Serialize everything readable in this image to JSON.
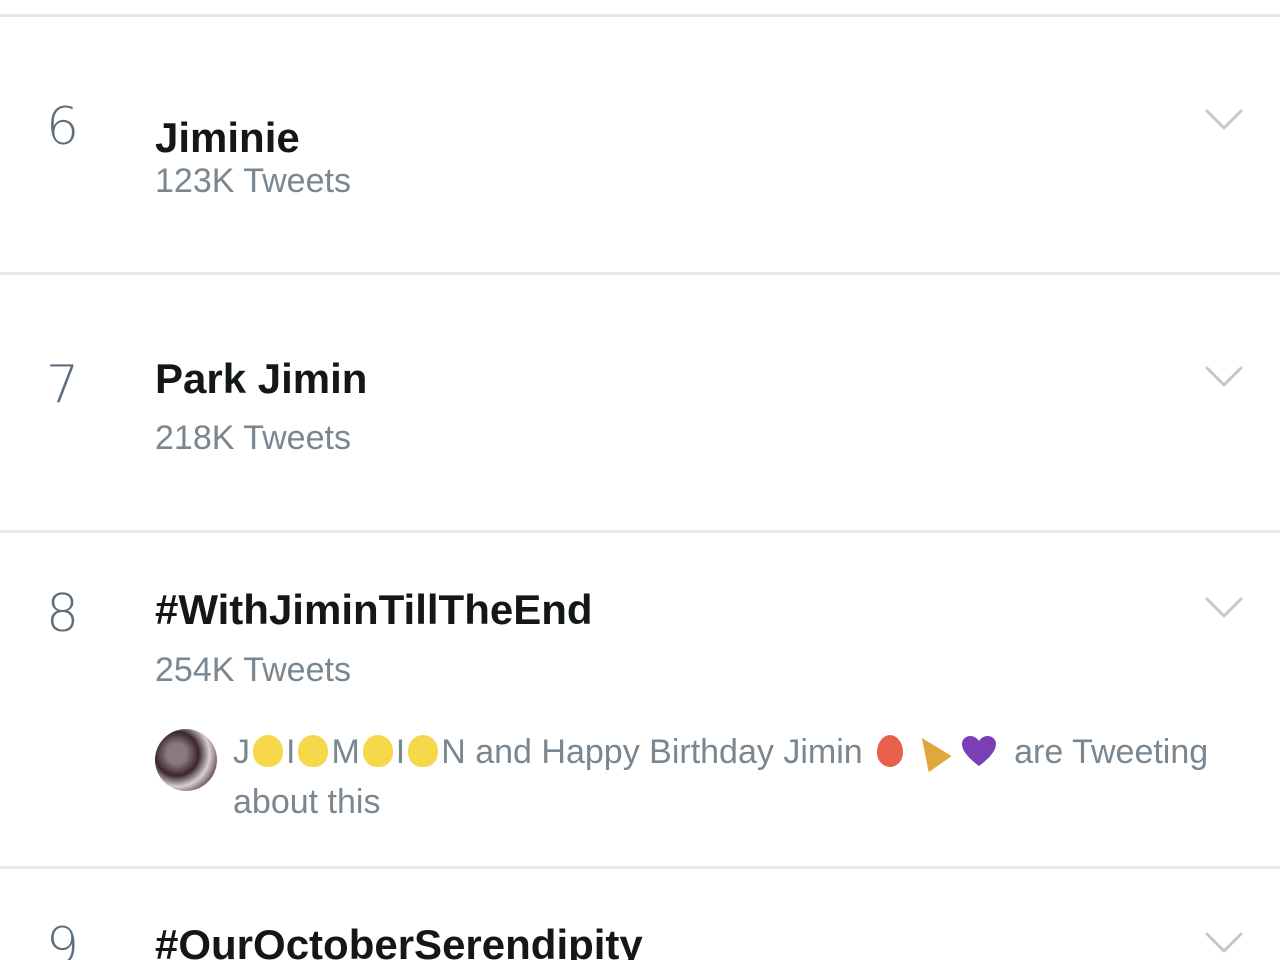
{
  "trends": [
    {
      "rank": "6",
      "name": "Jiminie",
      "tweets": "123K Tweets"
    },
    {
      "rank": "7",
      "name": "Park Jimin",
      "tweets": "218K Tweets"
    },
    {
      "rank": "8",
      "name": "#WithJiminTillTheEnd",
      "tweets": "254K Tweets",
      "context": {
        "letters": [
          "J",
          "I",
          "M",
          "I",
          "N"
        ],
        "text_after": " and Happy Birthday Jimin",
        "text_end": " are Tweeting about this"
      }
    },
    {
      "rank": "9",
      "name": "#OurOctoberSerendipity"
    }
  ],
  "colors": {
    "title": "#14171a",
    "secondary": "#7a8791",
    "rank": "#5e6e7c",
    "divider": "#e6e9ec",
    "chevron": "#c2c9cf",
    "heart": "#7b3fb5"
  },
  "icons": {
    "chevron": "chevron-down-icon",
    "chick": "baby-chick-emoji-icon",
    "balloon": "balloon-emoji-icon",
    "popper": "party-popper-emoji-icon",
    "heart": "purple-heart-emoji-icon"
  }
}
